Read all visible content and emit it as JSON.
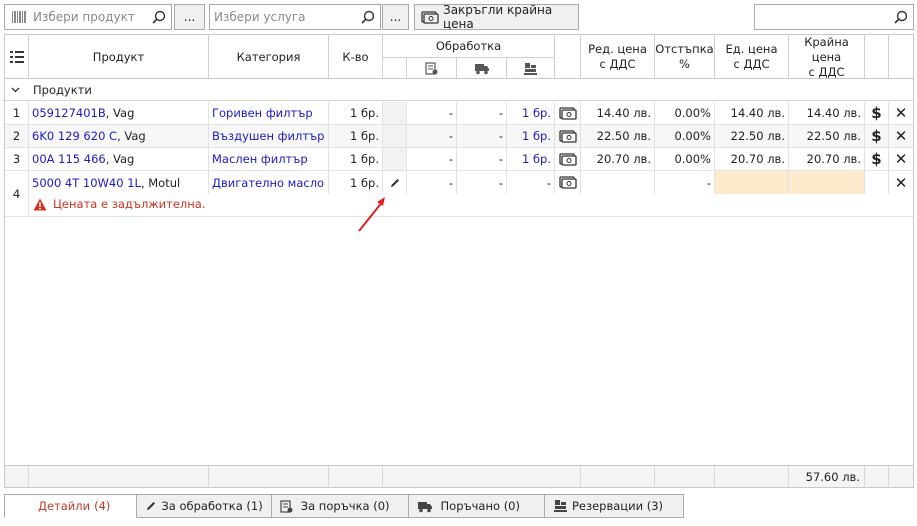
{
  "toolbar": {
    "product_placeholder": "Избери продукт",
    "service_placeholder": "Избери услуга",
    "browse_label": "...",
    "round_price_label": "Закръгли крайна цена",
    "search_value": ""
  },
  "columns": {
    "product": "Продукт",
    "category": "Категория",
    "qty": "К-во",
    "processing": "Обработка",
    "reg_price_l1": "Ред. цена",
    "reg_price_l2": "с ДДС",
    "discount_l1": "Отстъпка",
    "discount_l2": "%",
    "unit_price_l1": "Ед. цена",
    "unit_price_l2": "с ДДС",
    "final_price_l1": "Крайна цена",
    "final_price_l2": "с ДДС"
  },
  "group_label": "Продукти",
  "rows": [
    {
      "num": "1",
      "code": "059127401B",
      "brand": ", Vag",
      "category": "Горивен филтър",
      "qty": "1 бр.",
      "p1": "-",
      "p2": "-",
      "p3": "1 бр.",
      "reg": "14.40 лв.",
      "disc": "0.00%",
      "unit": "14.40 лв.",
      "final": "14.40 лв."
    },
    {
      "num": "2",
      "code": "6K0 129 620 C",
      "brand": ", Vag",
      "category": "Въздушен филтър",
      "qty": "1 бр.",
      "p1": "-",
      "p2": "-",
      "p3": "1 бр.",
      "reg": "22.50 лв.",
      "disc": "0.00%",
      "unit": "22.50 лв.",
      "final": "22.50 лв."
    },
    {
      "num": "3",
      "code": "00A 115 466",
      "brand": ", Vag",
      "category": "Маслен филтър",
      "qty": "1 бр.",
      "p1": "-",
      "p2": "-",
      "p3": "1 бр.",
      "reg": "20.70 лв.",
      "disc": "0.00%",
      "unit": "20.70 лв.",
      "final": "20.70 лв."
    },
    {
      "num": "4",
      "code": "5000 4T 10W40 1L",
      "brand": ", Motul",
      "category": "Двигателно масло",
      "qty": "1 бр.",
      "p1": "-",
      "p2": "-",
      "p3": "-",
      "reg": "",
      "disc": "-",
      "unit": "",
      "final": ""
    }
  ],
  "error_message": "Цената е задължителна.",
  "footer_total": "57.60 лв.",
  "tabs": [
    {
      "label": "Детайли",
      "count": "(4)"
    },
    {
      "label": "За обработка (1)"
    },
    {
      "label": "За поръчка (0)"
    },
    {
      "label": "Поръчано (0)"
    },
    {
      "label": "Резервации (3)"
    }
  ],
  "colors": {
    "link": "#1a1acc",
    "error": "#d03020",
    "annotation_arrow": "#e02020",
    "required_cell": "#fde9cc"
  }
}
